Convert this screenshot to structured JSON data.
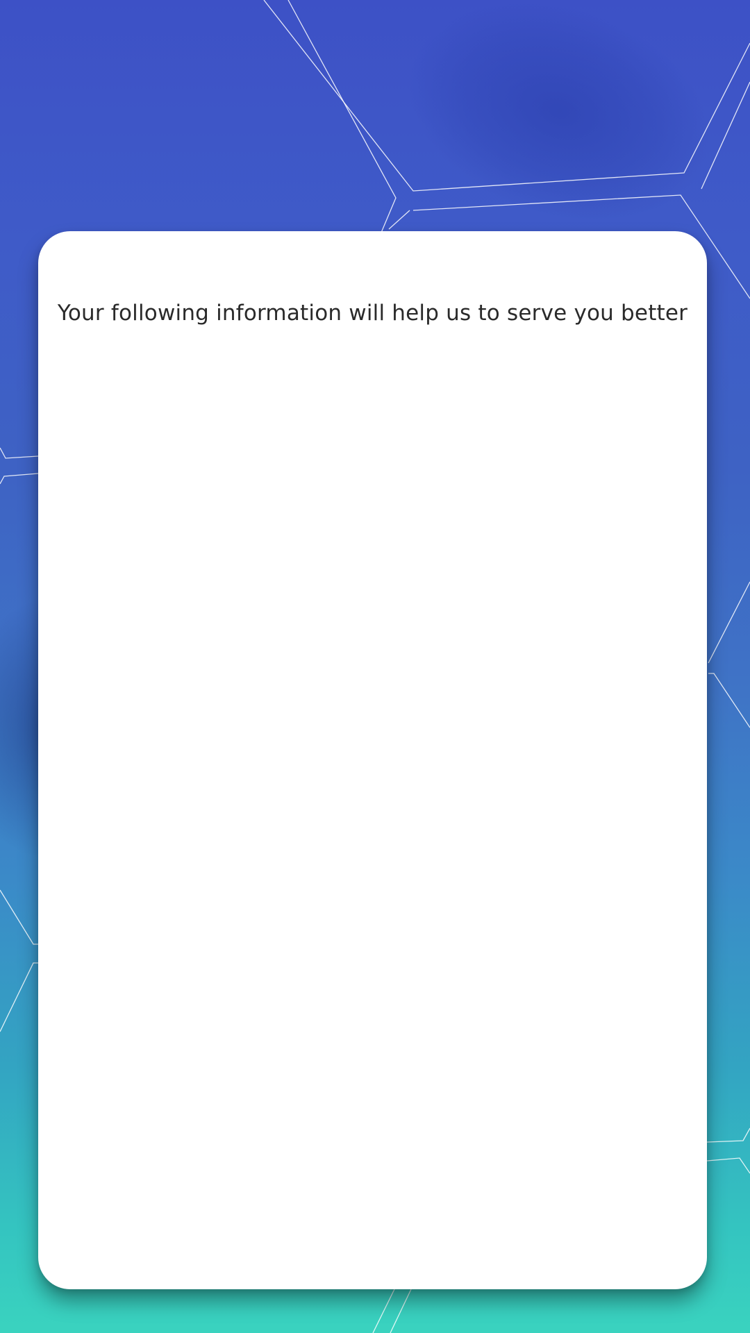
{
  "screen": {
    "background_gradient_top": "#3d51c6",
    "background_gradient_bottom": "#3ad3bf",
    "pattern_line_color": "#ffffff"
  },
  "card": {
    "message": "Your following information will help us to serve you better",
    "background": "#ffffff",
    "text_color": "#2a2a2a"
  }
}
